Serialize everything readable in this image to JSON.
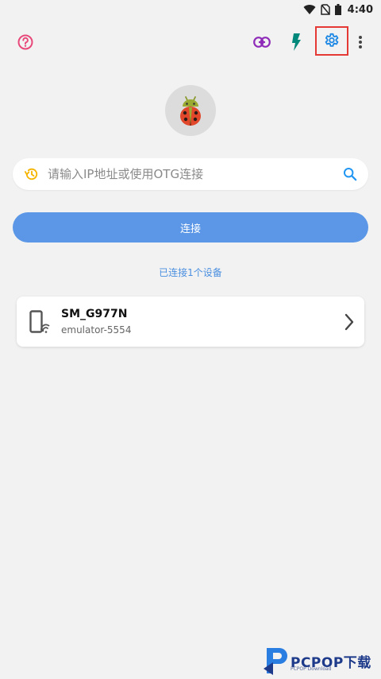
{
  "status_bar": {
    "time": "4:40"
  },
  "toolbar": {
    "help_icon": "help-circle-icon",
    "link_icon": "link-icon",
    "flash_icon": "flash-icon",
    "settings_icon": "gear-icon",
    "more_icon": "more-vert-icon"
  },
  "search": {
    "placeholder": "请输入IP地址或使用OTG连接",
    "value": ""
  },
  "connect_button": {
    "label": "连接"
  },
  "connected_info": "已连接1个设备",
  "devices": [
    {
      "name": "SM_G977N",
      "serial": "emulator-5554"
    }
  ],
  "watermark": {
    "brand": "PCPOP下载",
    "sub": "PCPOP Download"
  },
  "colors": {
    "accent_blue": "#5b97e6",
    "help_pink": "#e8497a",
    "link_purple": "#8e2bb8",
    "flash_teal": "#00897b",
    "settings_blue": "#1e88e5",
    "history_yellow": "#f5b400",
    "search_blue": "#2196f3",
    "highlight_red": "#e53935"
  }
}
